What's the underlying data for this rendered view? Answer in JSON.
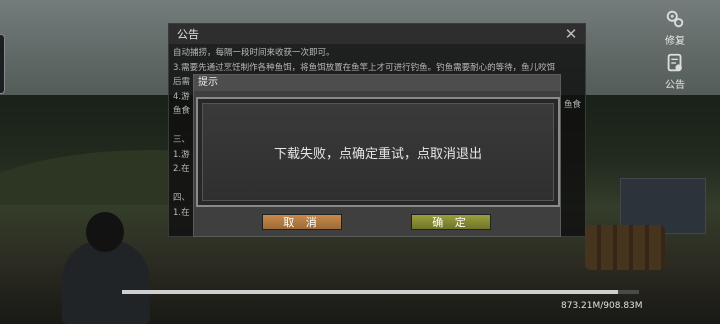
{
  "side_buttons": {
    "repair_label": "修复",
    "notice_label": "公告"
  },
  "notice": {
    "title": "公告",
    "close_symbol": "✕",
    "lines": [
      "自动捕捞，每隔一段时间来收获一次即可。",
      "3.需要先通过烹饪制作各种鱼饵，将鱼饵放置在鱼竿上才可进行钓鱼。钓鱼需要耐心的等待，鱼儿咬饵",
      "后需",
      "4.游",
      "鱼食",
      "",
      "三、",
      "1.游",
      "2.在",
      "",
      "四、",
      "1.在"
    ],
    "right_fragments": [
      "鱼食"
    ]
  },
  "dialog": {
    "title": "提示",
    "message": "下载失败，点确定重试，点取消退出",
    "cancel_label": "取 消",
    "ok_label": "确 定"
  },
  "download": {
    "progress_fraction": 0.96,
    "size_text": "873.21M/908.83M"
  },
  "colors": {
    "cancel_button": "#c78a4a",
    "ok_button": "#9a9e3c"
  }
}
